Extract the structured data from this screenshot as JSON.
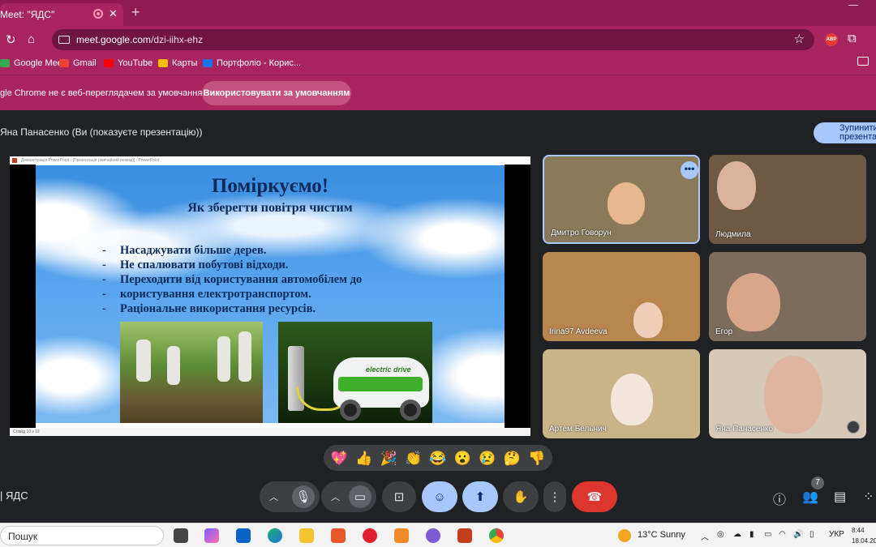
{
  "browser": {
    "tab_title": "Meet: \"ЯДС\"",
    "url_domain": "meet.google.com",
    "url_path": "/dzi-iihx-ehz",
    "bookmarks": [
      "Google Meet",
      "Gmail",
      "YouTube",
      "Карты",
      "Портфоліо - Корис..."
    ],
    "bookmark_colors": [
      "#34a853",
      "#ea4335",
      "#ff0000",
      "#fbbc04",
      "#1a73e8"
    ],
    "infobar_message": "gle Chrome не є веб-переглядачем за умовчанням",
    "infobar_button": "Використовувати за умовчанням"
  },
  "presentation": {
    "presenter_notice": "Яна Панасенко (Ви (показуєте презентацію))",
    "stop_line1": "Зупинити",
    "stop_line2": "презентацію",
    "window_title": "Демонстрація PowerPoint - [Презентація (звичайний режим)] - PowerPoint",
    "status_text": "Слайд 10 з 12",
    "slide": {
      "title": "Поміркуємо!",
      "subtitle": "Як зберегти повітря чистим",
      "bullets": [
        "Насаджувати більше дерев.",
        "Не спалювати побутові відходи.",
        "Переходити від користування автомобілем до",
        "користування електротранспортом.",
        "Раціональне використання ресурсів."
      ],
      "car_text": "electric drive"
    }
  },
  "participants": [
    {
      "name": "Дмитро Говорун",
      "bg": "#8a7a5a",
      "face": "#e7b790"
    },
    {
      "name": "Людмила",
      "bg": "#6e5a44",
      "face": "#d9b39a"
    },
    {
      "name": "Irina97 Avdeeva",
      "bg": "#b8874f",
      "face": "#f0cdb7"
    },
    {
      "name": "Егор",
      "bg": "#7d6b5b",
      "face": "#d8a78a"
    },
    {
      "name": "Артем Бельнич",
      "bg": "#c9b48a",
      "face": "#f3e5da"
    },
    {
      "name": "Яна Панасенко",
      "bg": "#d7c9b8",
      "face": "#e0b4a0"
    }
  ],
  "reactions": [
    "💖",
    "👍",
    "🎉",
    "👏",
    "😂",
    "😮",
    "😢",
    "🤔",
    "👎"
  ],
  "meeting": {
    "name": "ЯДС",
    "people_count": "7"
  },
  "taskbar": {
    "search": "Пошук",
    "weather": "13°C  Sunny",
    "lang": "УКР",
    "time": "8:44",
    "date": "18.04.20"
  }
}
